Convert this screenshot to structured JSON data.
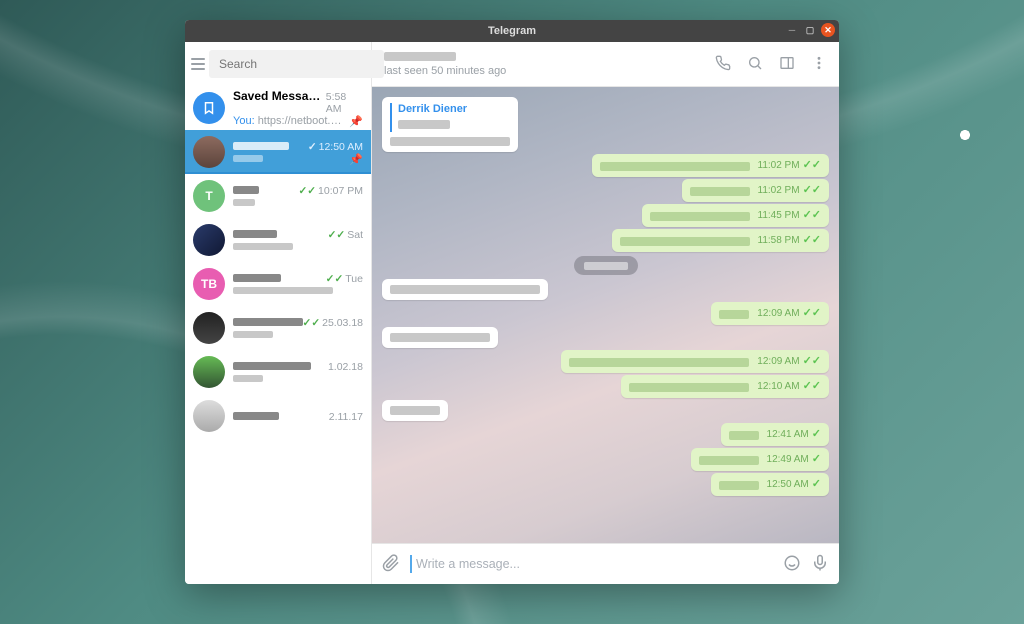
{
  "window": {
    "title": "Telegram"
  },
  "search": {
    "placeholder": "Search"
  },
  "chats": {
    "saved": {
      "name": "Saved Messages",
      "time": "5:58 AM",
      "you": "You:",
      "link": "https://netboot.xyz..."
    },
    "selected": {
      "time": "12:50 AM"
    },
    "t": {
      "letter": "T",
      "time": "10:07 PM"
    },
    "c3": {
      "time": "Sat"
    },
    "c4": {
      "letter": "TB",
      "time": "Tue"
    },
    "c5": {
      "time": "25.03.18"
    },
    "c6": {
      "time": "1.02.18"
    },
    "c7": {
      "time": "2.11.17"
    }
  },
  "pane": {
    "status": "last seen 50 minutes ago"
  },
  "fwd": {
    "name": "Derrik Diener"
  },
  "msgs": {
    "r1": "11:02 PM",
    "r2": "11:02 PM",
    "r3": "11:45 PM",
    "r4": "11:58 PM",
    "r5": "12:09 AM",
    "r6": "12:09 AM",
    "r7": "12:10 AM",
    "r8": "12:41 AM",
    "r9": "12:49 AM",
    "r10": "12:50 AM"
  },
  "ticks": {
    "double": "✓✓",
    "single": "✓"
  },
  "composer": {
    "placeholder": "Write a message..."
  }
}
